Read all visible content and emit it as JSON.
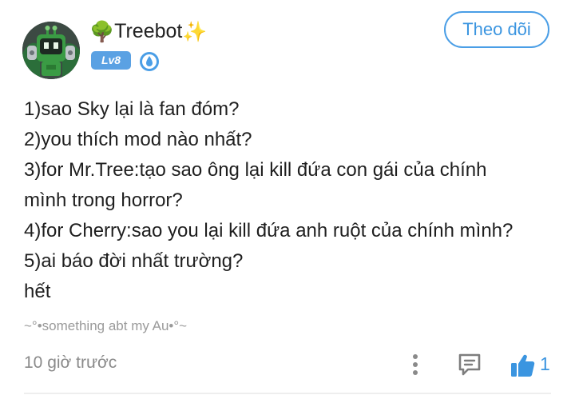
{
  "author": {
    "name": "Treebot",
    "name_prefix_emoji": "🌳",
    "name_suffix_emoji": "✨",
    "level": "Lv8",
    "avatar_icon": "robot-avatar",
    "badge_icon": "water-drop-badge-icon"
  },
  "follow_button": {
    "label": "Theo dõi"
  },
  "post": {
    "lines": [
      "1)sao Sky lại là fan đóm?",
      "2)you thích mod nào nhất?",
      "3)for Mr.Tree:tạo sao ông lại kill đứa con gái của chính",
      "mình trong horror?",
      "4)for Cherry:sao you lại kill đứa anh ruột của chính mình?",
      "5)ai báo đời nhất trường?",
      "hết"
    ],
    "signature": "~°•something abt my Au•°~"
  },
  "footer": {
    "timestamp": "10 giờ trước",
    "like_count": "1",
    "icons": {
      "more": "more-vertical-icon",
      "reply": "comment-icon",
      "like": "thumbs-up-icon"
    }
  },
  "colors": {
    "accent": "#3b95e0",
    "level_badge": "#5aa1e3",
    "text": "#1f1f1f",
    "muted": "#8a8a8a"
  }
}
